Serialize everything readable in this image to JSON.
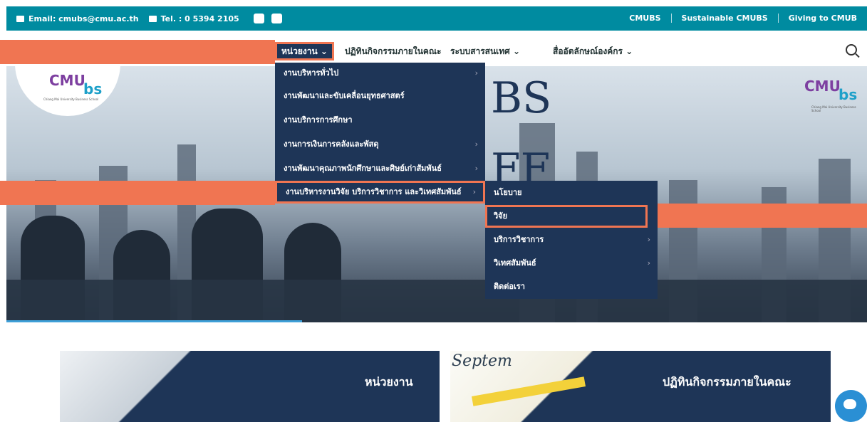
{
  "topbar": {
    "email": "Email: cmubs@cmu.ac.th",
    "tel": "Tel. : 0 5394 2105",
    "links": [
      "CMUBS",
      "Sustainable CMUBS",
      "Giving to CMUB"
    ]
  },
  "nav": {
    "items": [
      {
        "label": "หน่วยงาน",
        "caret": "⌄"
      },
      {
        "label": "ปฏิทินกิจกรรมภายในคณะ",
        "caret": ""
      },
      {
        "label": "ระบบสารสนเทศ",
        "caret": "⌄"
      },
      {
        "label": "สื่ออัตลักษณ์องค์กร",
        "caret": "⌄"
      }
    ]
  },
  "hero": {
    "logo_main": "CMU",
    "logo_bs": "bs",
    "logo_sub": "Chiang Mai University Business School",
    "big_line1": "BS",
    "big_line2": "FF"
  },
  "menu": [
    {
      "label": "งานบริหารทั่วไป",
      "arrow": "›"
    },
    {
      "label": "งานพัฒนาและขับเคลื่อนยุทธศาสตร์",
      "arrow": ""
    },
    {
      "label": "งานบริการการศึกษา",
      "arrow": ""
    },
    {
      "label": "งานการเงินการคลังและพัสดุ",
      "arrow": "›"
    },
    {
      "label": "งานพัฒนาคุณภาพนักศึกษาและศิษย์เก่าสัมพันธ์",
      "arrow": "›"
    },
    {
      "label": "งานบริหารงานวิจัย บริการวิชาการ และวิเทศสัมพันธ์",
      "arrow": "›"
    }
  ],
  "submenu": [
    {
      "label": "นโยบาย",
      "arrow": ""
    },
    {
      "label": "วิจัย",
      "arrow": ""
    },
    {
      "label": "บริการวิชาการ",
      "arrow": "›"
    },
    {
      "label": "วิเทศสัมพันธ์",
      "arrow": "›"
    },
    {
      "label": "ติดต่อเรา",
      "arrow": ""
    }
  ],
  "cards": {
    "left_title": "หน่วยงาน",
    "right_title": "ปฏิทินกิจกรรมภายในคณะ",
    "calendar_word": "Septem"
  },
  "colors": {
    "primary": "#1e3557",
    "topbar": "#008ba0",
    "highlight": "#f07552"
  }
}
